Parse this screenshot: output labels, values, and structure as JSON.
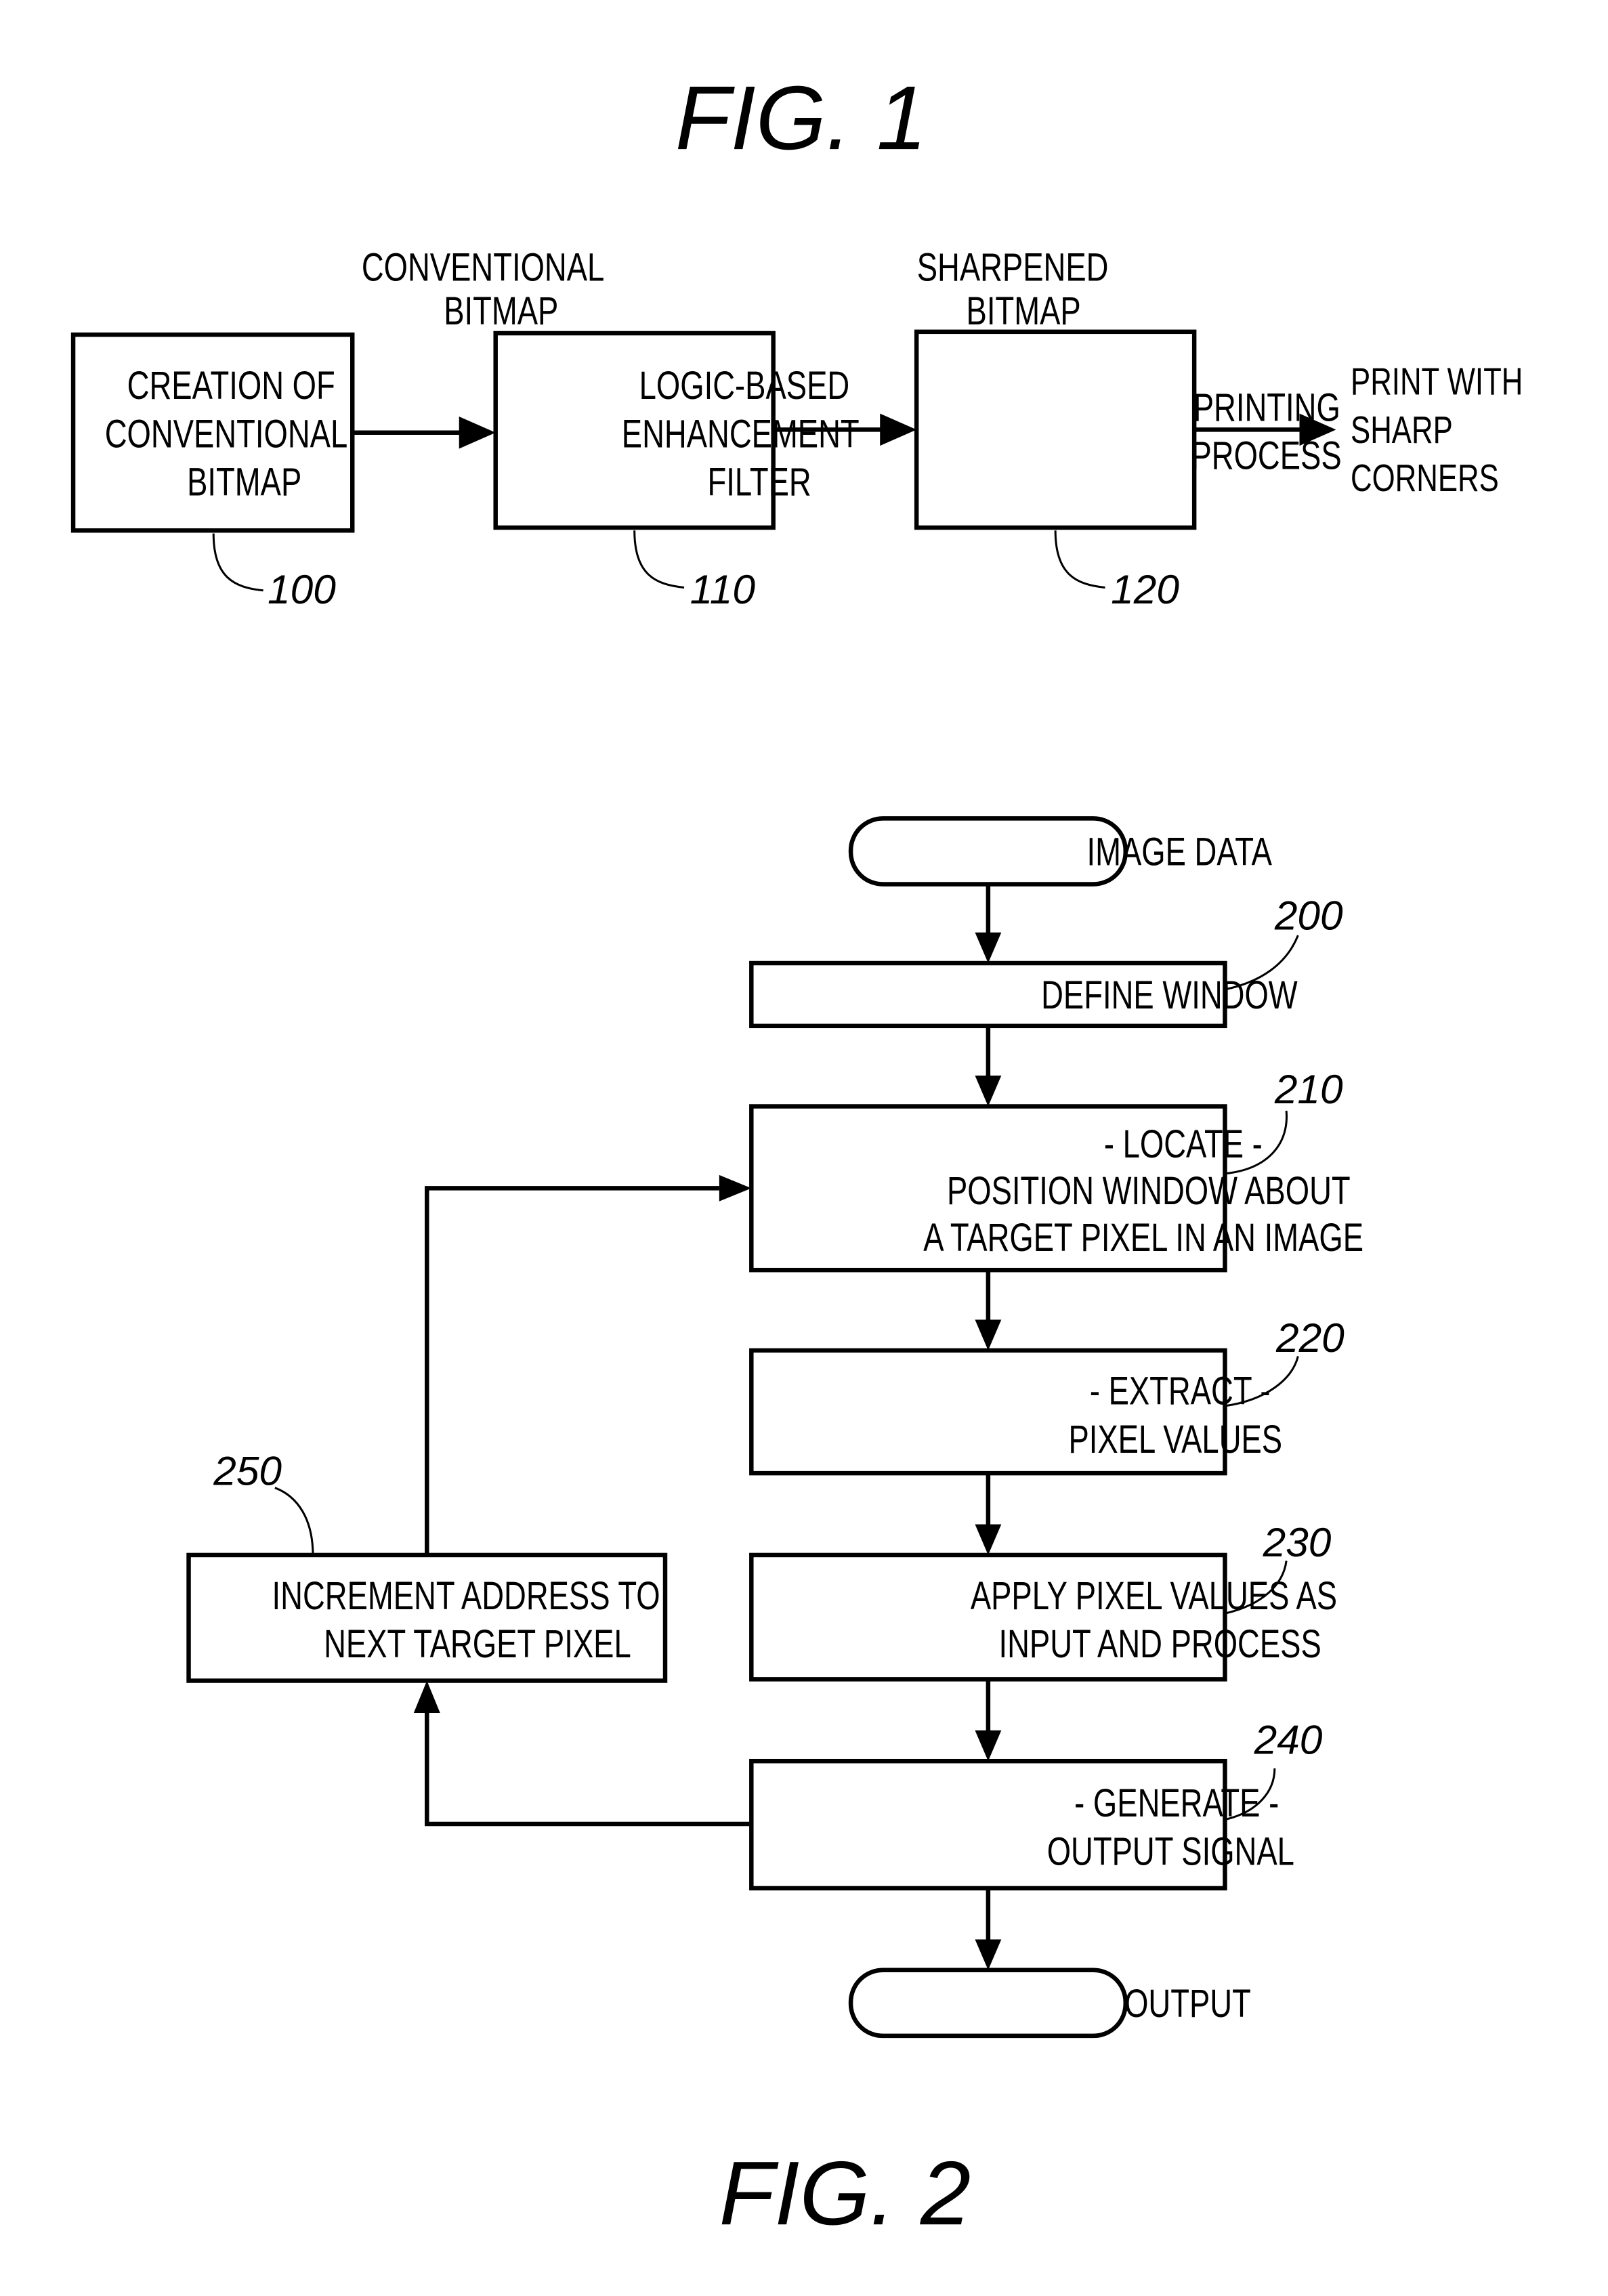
{
  "fig1": {
    "title": "FIG. 1",
    "blocks": [
      {
        "id": "100",
        "lines": [
          "CREATION OF",
          "CONVENTIONAL",
          "BITMAP"
        ]
      },
      {
        "id": "110",
        "lines": [
          "LOGIC-BASED",
          "ENHANCEMENT",
          "FILTER"
        ]
      },
      {
        "id": "120",
        "lines": [
          "PRINTING",
          "PROCESS"
        ]
      }
    ],
    "edge_labels": [
      {
        "lines": [
          "CONVENTIONAL",
          "BITMAP"
        ]
      },
      {
        "lines": [
          "SHARPENED",
          "BITMAP"
        ]
      }
    ],
    "output_label": [
      "PRINT WITH",
      "SHARP",
      "CORNERS"
    ]
  },
  "fig2": {
    "title": "FIG. 2",
    "start": "IMAGE DATA",
    "end": "OUTPUT",
    "steps": [
      {
        "id": "200",
        "lines": [
          "DEFINE WINDOW"
        ]
      },
      {
        "id": "210",
        "lines": [
          "- LOCATE -",
          "POSITION WINDOW ABOUT",
          "A TARGET PIXEL IN AN IMAGE"
        ]
      },
      {
        "id": "220",
        "lines": [
          "- EXTRACT -",
          "PIXEL VALUES"
        ]
      },
      {
        "id": "230",
        "lines": [
          "APPLY PIXEL VALUES AS",
          "INPUT AND PROCESS"
        ]
      },
      {
        "id": "240",
        "lines": [
          "- GENERATE -",
          "OUTPUT SIGNAL"
        ]
      },
      {
        "id": "250",
        "lines": [
          "INCREMENT ADDRESS TO",
          "NEXT TARGET PIXEL"
        ]
      }
    ]
  }
}
